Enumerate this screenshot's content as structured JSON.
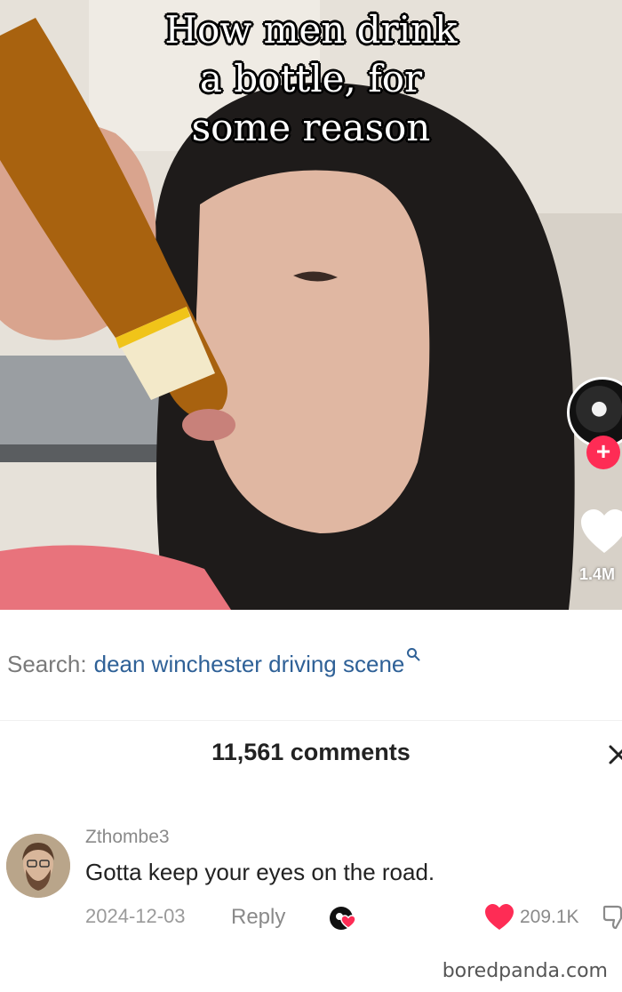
{
  "video": {
    "caption_lines": [
      "How men drink",
      "a bottle, for",
      "some reason"
    ],
    "like_count": "1.4M",
    "follow_symbol": "+"
  },
  "search": {
    "prefix": "Search:",
    "query": "dean winchester driving scene"
  },
  "comments": {
    "count_label": "11,561 comments",
    "items": [
      {
        "username": "Zthombe3",
        "text": "Gotta keep your eyes on the road.",
        "date": "2024-12-03",
        "reply_label": "Reply",
        "likes": "209.1K"
      }
    ]
  },
  "watermark": "boredpanda.com",
  "colors": {
    "accent_red": "#fe2c55",
    "search_link": "#2f6197",
    "muted_text": "#8a8a8a"
  },
  "icons": [
    "close-icon",
    "search-icon",
    "heart-icon",
    "creator-liked-icon",
    "dislike-icon"
  ]
}
